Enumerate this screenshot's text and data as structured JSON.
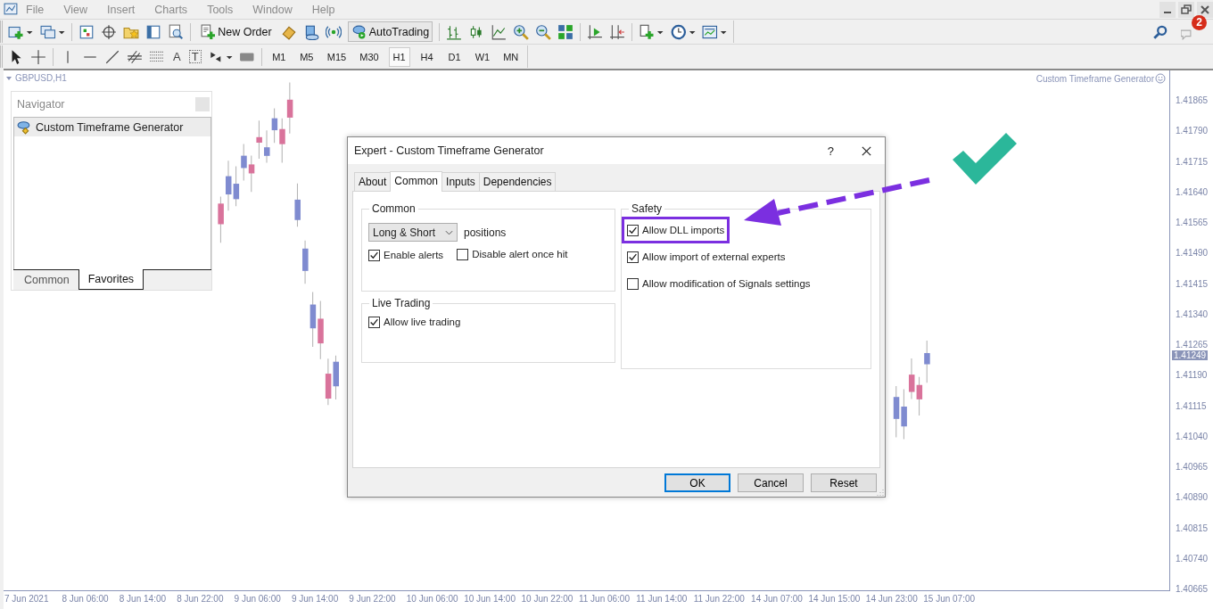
{
  "menu": [
    "File",
    "View",
    "Insert",
    "Charts",
    "Tools",
    "Window",
    "Help"
  ],
  "notifications": {
    "count": "2"
  },
  "toolbar": {
    "new_order": "New Order",
    "autotrading": "AutoTrading"
  },
  "drawing_tools": {
    "text_tool": "A",
    "label_tool": "T"
  },
  "timeframes": [
    {
      "label": "M1",
      "selected": false
    },
    {
      "label": "M5",
      "selected": false
    },
    {
      "label": "M15",
      "selected": false
    },
    {
      "label": "M30",
      "selected": false
    },
    {
      "label": "H1",
      "selected": true
    },
    {
      "label": "H4",
      "selected": false
    },
    {
      "label": "D1",
      "selected": false
    },
    {
      "label": "W1",
      "selected": false
    },
    {
      "label": "MN",
      "selected": false
    }
  ],
  "chart": {
    "symbol": "GBPUSD,H1",
    "expert": "Custom Timeframe Generator",
    "current_price": "1.41249",
    "price_labels": [
      "1.41865",
      "1.41790",
      "1.41715",
      "1.41640",
      "1.41565",
      "1.41490",
      "1.41415",
      "1.41340",
      "1.41265",
      "1.41190",
      "1.41115",
      "1.41040",
      "1.40965",
      "1.40890",
      "1.40815",
      "1.40740",
      "1.40665"
    ],
    "time_labels": [
      "7 Jun 2021",
      "8 Jun 06:00",
      "8 Jun 14:00",
      "8 Jun 22:00",
      "9 Jun 06:00",
      "9 Jun 14:00",
      "9 Jun 22:00",
      "10 Jun 06:00",
      "10 Jun 14:00",
      "10 Jun 22:00",
      "11 Jun 06:00",
      "11 Jun 14:00",
      "11 Jun 22:00",
      "14 Jun 07:00",
      "14 Jun 15:00",
      "14 Jun 23:00",
      "15 Jun 07:00"
    ]
  },
  "navigator": {
    "title": "Navigator",
    "items": [
      "Custom Timeframe Generator"
    ],
    "tabs": [
      {
        "label": "Common",
        "selected": false
      },
      {
        "label": "Favorites",
        "selected": true
      }
    ]
  },
  "dialog": {
    "title": "Expert - Custom Timeframe Generator",
    "help": "?",
    "tabs": [
      {
        "label": "About",
        "selected": false
      },
      {
        "label": "Common",
        "selected": true
      },
      {
        "label": "Inputs",
        "selected": false
      },
      {
        "label": "Dependencies",
        "selected": false
      }
    ],
    "common": {
      "title": "Common",
      "positions": {
        "value": "Long & Short",
        "label": "positions"
      },
      "options": [
        {
          "label": "Enable alerts",
          "checked": true,
          "children": [
            {
              "label": "Disable alert once hit",
              "checked": false
            }
          ]
        }
      ]
    },
    "live_trading": {
      "title": "Live Trading",
      "options": [
        {
          "label": "Allow live trading",
          "checked": true
        }
      ]
    },
    "safety": {
      "title": "Safety",
      "options": [
        {
          "label": "Allow DLL imports",
          "checked": true,
          "highlighted": true
        },
        {
          "label": "Allow import of external experts",
          "checked": true,
          "highlighted": false
        },
        {
          "label": "Allow modification of Signals settings",
          "checked": false,
          "highlighted": false
        }
      ]
    },
    "buttons": [
      {
        "label": "OK",
        "default": true
      },
      {
        "label": "Cancel",
        "default": false
      },
      {
        "label": "Reset",
        "default": false
      }
    ]
  }
}
